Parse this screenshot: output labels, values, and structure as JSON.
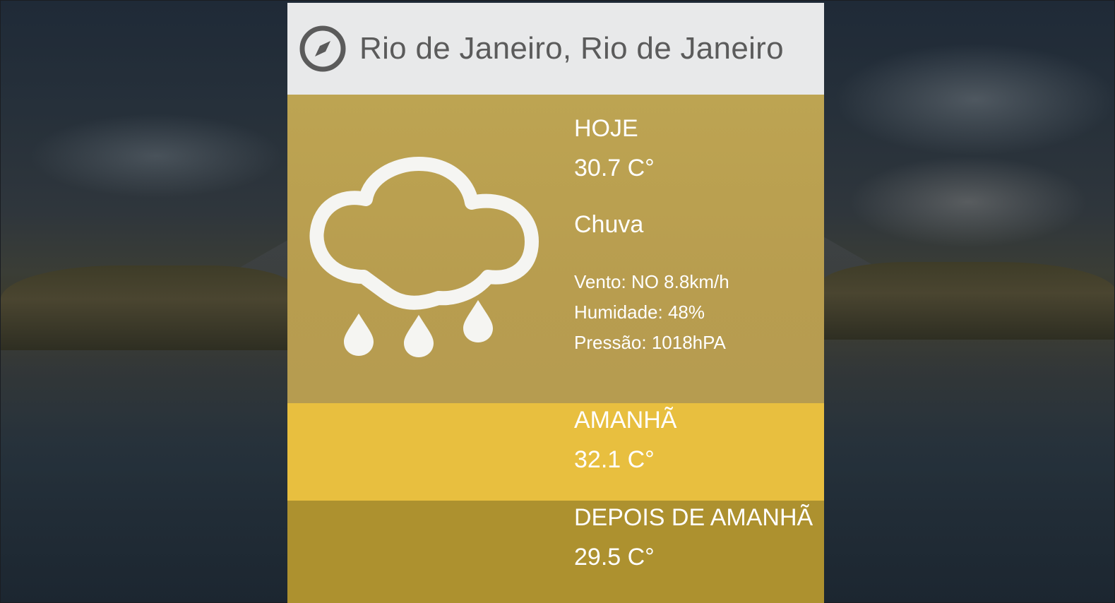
{
  "location": {
    "icon": "compass-icon",
    "city": "Rio de Janeiro, Rio de Janeiro"
  },
  "today": {
    "label": "HOJE",
    "temperature": "30.7 C°",
    "condition": "Chuva",
    "icon": "rain-cloud-icon",
    "wind": "Vento: NO 8.8km/h",
    "humidity": "Humidade: 48%",
    "pressure": "Pressão: 1018hPA"
  },
  "tomorrow": {
    "label": "AMANHÃ",
    "temperature": "32.1 C°"
  },
  "after_tomorrow": {
    "label": "DEPOIS DE AMANHÃ",
    "temperature": "29.5 C°"
  },
  "colors": {
    "header_bg": "#e8e9ea",
    "today_bg": "#b89d4f",
    "tomorrow_bg": "#e8bf3f",
    "after_bg": "#ad912f",
    "text_light": "#ffffff",
    "text_header": "#5b5b5b"
  }
}
